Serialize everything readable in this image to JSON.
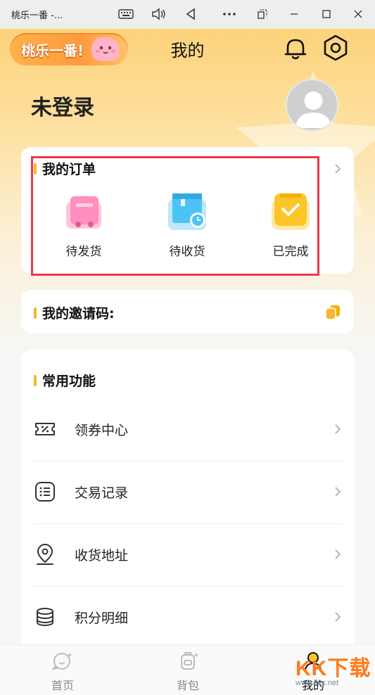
{
  "window": {
    "title": "桃乐一番 -..."
  },
  "header": {
    "logo_text": "桃乐一番!",
    "page_title": "我的",
    "login_status": "未登录"
  },
  "orders": {
    "title": "我的订单",
    "items": [
      {
        "label": "待发货",
        "icon": "pending-shipment-icon"
      },
      {
        "label": "待收货",
        "icon": "pending-receipt-icon"
      },
      {
        "label": "已完成",
        "icon": "completed-icon"
      }
    ]
  },
  "invite": {
    "title": "我的邀请码:"
  },
  "functions": {
    "title": "常用功能",
    "items": [
      {
        "label": "领券中心",
        "icon": "coupon-icon"
      },
      {
        "label": "交易记录",
        "icon": "transaction-list-icon"
      },
      {
        "label": "收货地址",
        "icon": "location-pin-icon"
      },
      {
        "label": "积分明细",
        "icon": "coin-stack-icon"
      }
    ]
  },
  "bottom_nav": {
    "items": [
      {
        "label": "首页",
        "active": false
      },
      {
        "label": "背包",
        "active": false
      },
      {
        "label": "我的",
        "active": true
      }
    ]
  },
  "watermark": {
    "text": "KK下载",
    "url": "www.kkx.net"
  },
  "colors": {
    "accent_yellow": "#f7b731",
    "highlight_red": "#e8394a",
    "header_gradient_top": "#fdd37a"
  }
}
